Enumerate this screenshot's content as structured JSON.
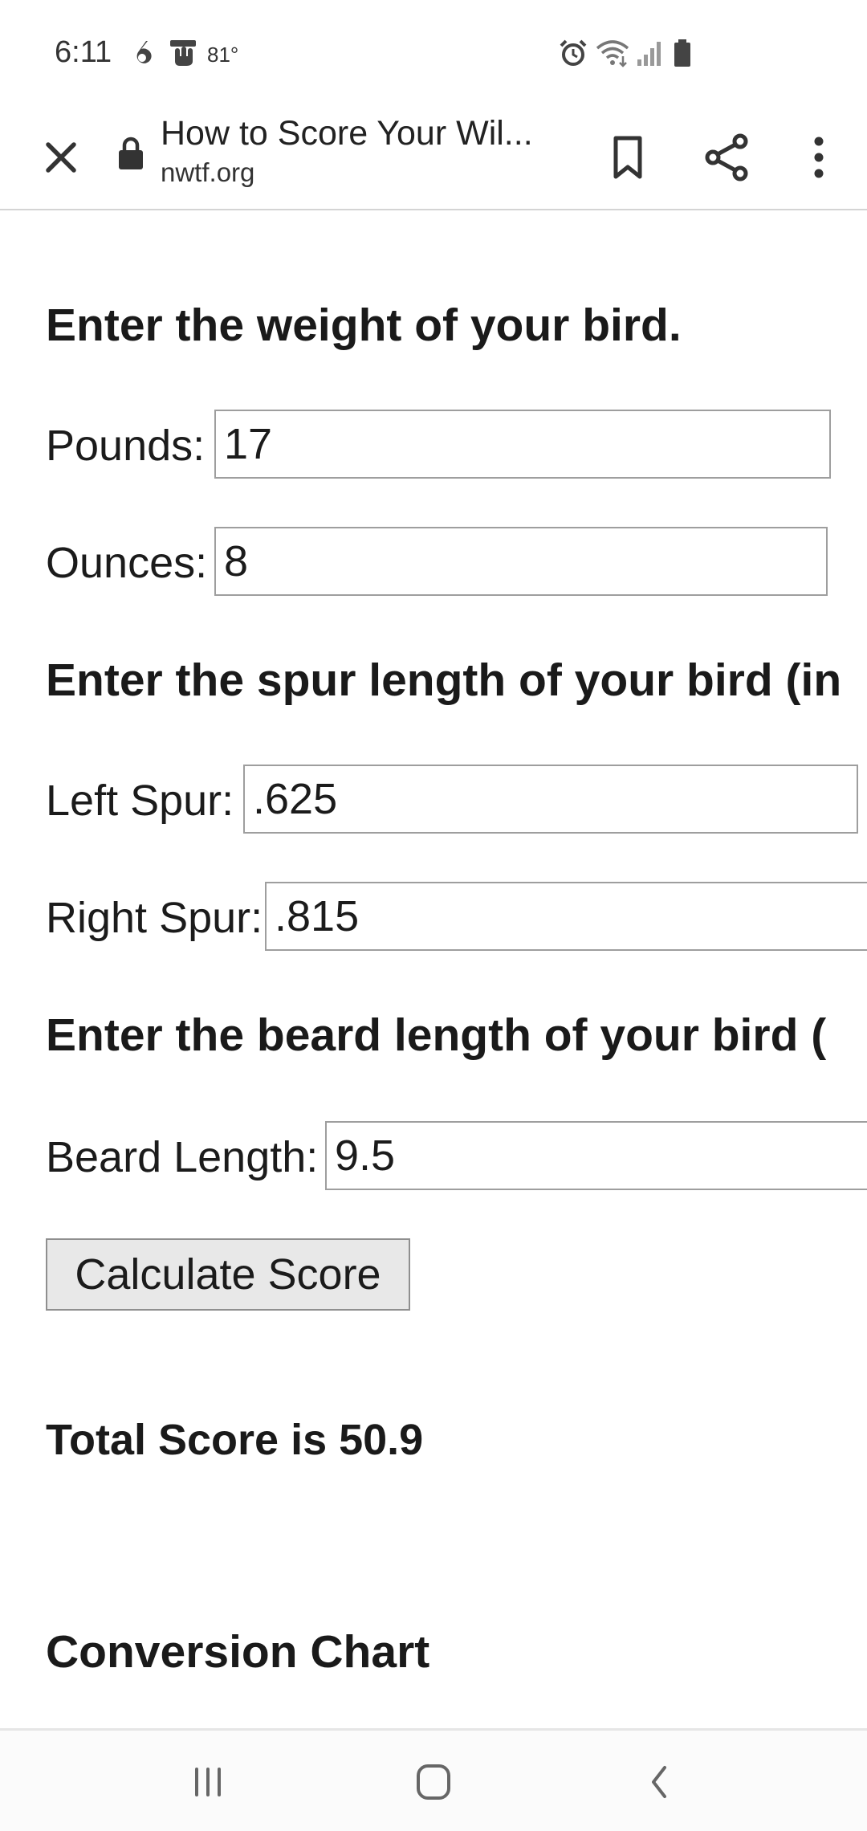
{
  "status_bar": {
    "time": "6:11",
    "temperature": "81°",
    "icons": [
      "notification-6-icon",
      "hand-icon",
      "alarm-icon",
      "wifi-icon",
      "signal-icon",
      "battery-icon"
    ]
  },
  "browser": {
    "page_title": "How to Score Your Wil...",
    "domain": "nwtf.org",
    "icons": [
      "close-icon",
      "lock-icon",
      "bookmark-icon",
      "share-icon",
      "more-vert-icon"
    ]
  },
  "form": {
    "weight_heading": "Enter the weight of your bird.",
    "pounds_label": "Pounds:",
    "pounds_value": "17",
    "ounces_label": "Ounces:",
    "ounces_value": "8",
    "spur_heading": "Enter the spur length of your bird (in",
    "left_spur_label": "Left Spur:",
    "left_spur_value": ".625",
    "right_spur_label": "Right Spur:",
    "right_spur_value": ".815",
    "beard_heading": "Enter the beard length of your bird (",
    "beard_label": "Beard Length:",
    "beard_value": "9.5",
    "calculate_label": "Calculate Score",
    "result_text": "Total Score is 50.9",
    "conversion_heading": "Conversion Chart"
  },
  "nav_bar": {
    "icons": [
      "recent-apps-icon",
      "home-icon",
      "back-icon"
    ]
  }
}
